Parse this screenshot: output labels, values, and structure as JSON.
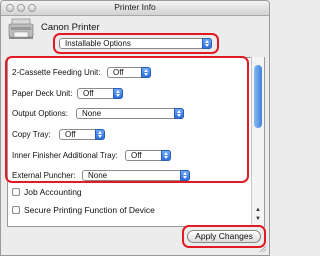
{
  "window": {
    "title": "Printer Info"
  },
  "printer": {
    "name": "Canon Printer"
  },
  "category_popup": {
    "selected": "Installable Options"
  },
  "options": [
    {
      "label": "2-Cassette Feeding Unit:",
      "value": "Off"
    },
    {
      "label": "Paper Deck Unit:",
      "value": "Off"
    },
    {
      "label": "Output Options:",
      "value": "None"
    },
    {
      "label": "Copy Tray:",
      "value": "Off"
    },
    {
      "label": "Inner Finisher Additional Tray:",
      "value": "Off"
    },
    {
      "label": "External Puncher:",
      "value": "None"
    }
  ],
  "checkboxes": [
    {
      "label": "Job Accounting",
      "checked": false
    },
    {
      "label": "Secure Printing Function of Device",
      "checked": false
    }
  ],
  "apply_button": {
    "label": "Apply Changes"
  },
  "colors": {
    "highlight": "#e01b24",
    "popup_arrow": "#2c6fde"
  }
}
